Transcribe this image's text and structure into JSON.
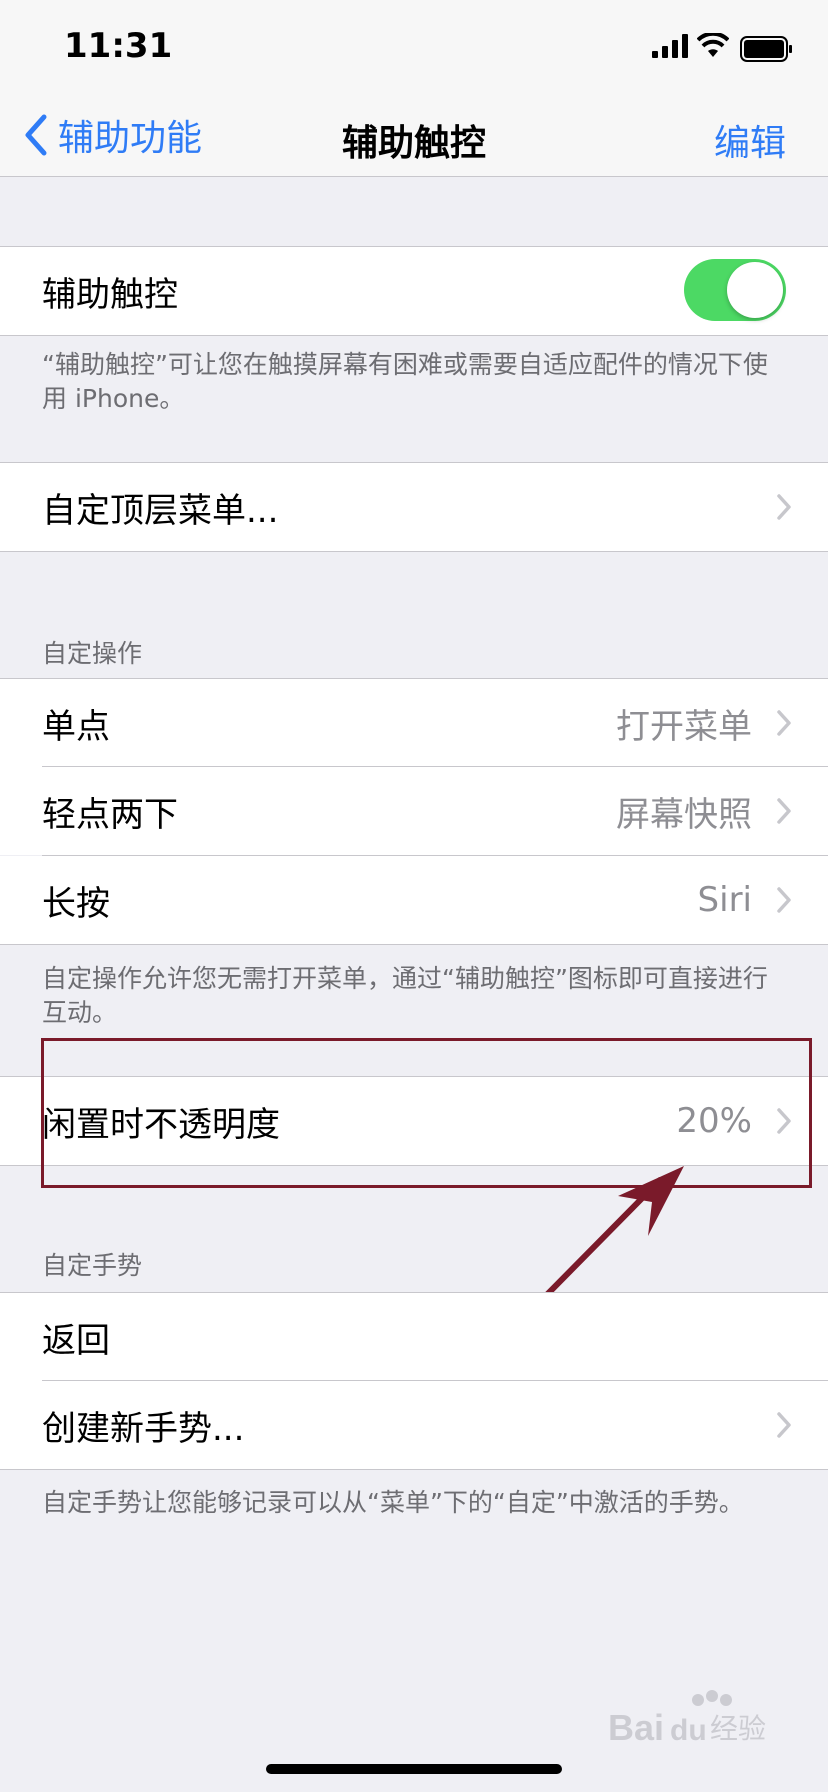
{
  "status": {
    "time": "11:31"
  },
  "nav": {
    "back_label": "辅助功能",
    "title": "辅助触控",
    "edit_label": "编辑"
  },
  "toggle_row": {
    "label": "辅助触控",
    "enabled": true
  },
  "toggle_footer": "“辅助触控”可让您在触摸屏幕有困难或需要自适应配件的情况下使用 iPhone。",
  "customize_menu": {
    "label": "自定顶层菜单..."
  },
  "custom_actions": {
    "header": "自定操作",
    "items": [
      {
        "label": "单点",
        "value": "打开菜单"
      },
      {
        "label": "轻点两下",
        "value": "屏幕快照"
      },
      {
        "label": "长按",
        "value": "Siri"
      }
    ],
    "footer": "自定操作允许您无需打开菜单，通过“辅助触控”图标即可直接进行互动。"
  },
  "idle_opacity": {
    "label": "闲置时不透明度",
    "value": "20%"
  },
  "custom_gestures": {
    "header": "自定手势",
    "items": [
      {
        "label": "返回"
      },
      {
        "label": "创建新手势..."
      }
    ],
    "footer": "自定手势让您能够记录可以从“菜单”下的“自定”中激活的手势。"
  },
  "watermark": {
    "text": "Baidu经验"
  },
  "colors": {
    "accent": "#2f7cf6",
    "toggle_on": "#4cd964",
    "annotation": "#7a1a2a"
  }
}
